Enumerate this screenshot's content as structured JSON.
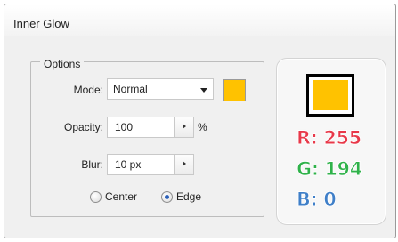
{
  "dialog": {
    "title": "Inner Glow"
  },
  "options": {
    "legend": "Options",
    "mode": {
      "label": "Mode:",
      "value": "Normal",
      "swatch_color": "#ffc200"
    },
    "opacity": {
      "label": "Opacity:",
      "value": "100",
      "unit": "%"
    },
    "blur": {
      "label": "Blur:",
      "value": "10 px"
    },
    "source": {
      "center_label": "Center",
      "edge_label": "Edge",
      "selected": "Edge"
    }
  },
  "color_panel": {
    "swatch_color": "#ffc200",
    "r_text": "R: 255",
    "g_text": "G: 194",
    "b_text": "B: 0",
    "r_color": "#e8394a",
    "g_color": "#2fb24a",
    "b_color": "#3f7fc8"
  }
}
